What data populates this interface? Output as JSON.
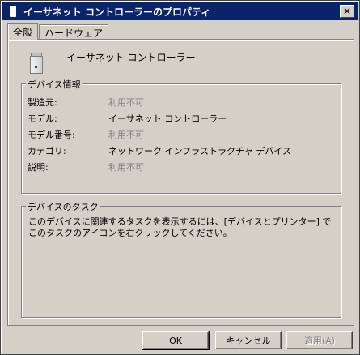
{
  "window": {
    "title": "イーサネット コントローラーのプロパティ"
  },
  "tabs": [
    {
      "label": "全般"
    },
    {
      "label": "ハードウェア"
    }
  ],
  "device": {
    "name": "イーサネット コントローラー",
    "icon": "device-tower-icon"
  },
  "device_info": {
    "title": "デバイス情報",
    "rows": [
      {
        "label": "製造元:",
        "value": "利用不可"
      },
      {
        "label": "モデル:",
        "value": "イーサネット コントローラー"
      },
      {
        "label": "モデル番号:",
        "value": "利用不可"
      },
      {
        "label": "カテゴリ:",
        "value": "ネットワーク インフラストラクチャ デバイス"
      },
      {
        "label": "説明:",
        "value": "利用不可"
      }
    ]
  },
  "tasks": {
    "title": "デバイスのタスク",
    "text": "このデバイスに関連するタスクを表示するには、[デバイスとプリンター] でこのタスクのアイコンを右クリックしてください。"
  },
  "buttons": {
    "ok": "OK",
    "cancel": "キャンセル",
    "apply": "適用(A)"
  }
}
